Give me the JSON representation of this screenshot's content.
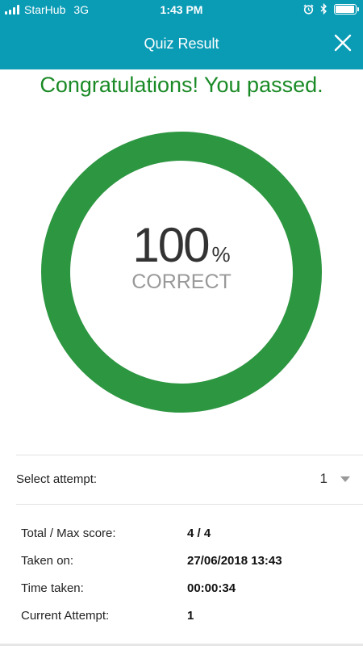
{
  "status_bar": {
    "carrier": "StarHub",
    "network": "3G",
    "time": "1:43 PM",
    "icons": [
      "signal-icon",
      "alarm-icon",
      "bluetooth-icon",
      "battery-icon"
    ],
    "battery_level": 0.95
  },
  "header": {
    "title": "Quiz Result",
    "close_icon": "close-icon",
    "background": "#0a9bb5"
  },
  "result": {
    "message": "Congratulations! You passed.",
    "score": "100",
    "score_unit": "%",
    "score_label": "CORRECT",
    "progress": 1.0,
    "ring_color": "#2c9640",
    "message_color": "#1a8a26"
  },
  "attempt_select": {
    "label": "Select attempt:",
    "selected": "1",
    "icon": "caret-down-icon"
  },
  "details": [
    {
      "key": "Total / Max score:",
      "value": "4 / 4"
    },
    {
      "key": "Taken on:",
      "value": "27/06/2018 13:43"
    },
    {
      "key": "Time taken:",
      "value": "00:00:34"
    },
    {
      "key": "Current Attempt:",
      "value": "1"
    }
  ]
}
